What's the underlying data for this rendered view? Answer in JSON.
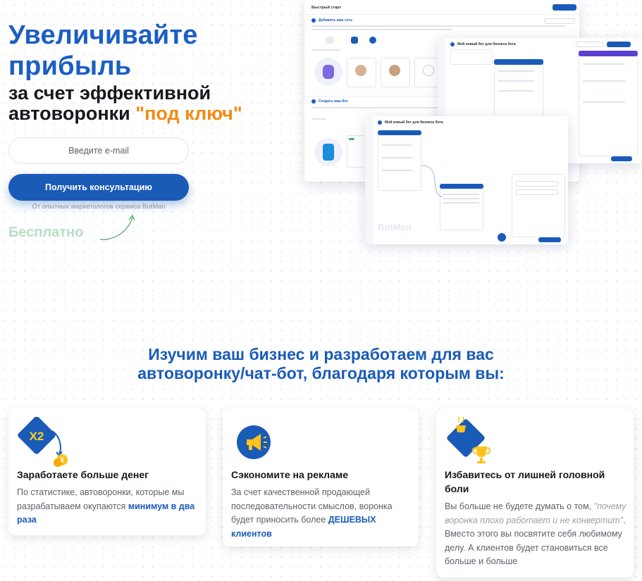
{
  "hero": {
    "title_line1": "Увеличивайте",
    "title_line2": "прибыль",
    "subtitle_line1": "за счет эффективной",
    "subtitle_line2_prefix": "автоворонки ",
    "subtitle_highlight": "\"под ключ\"",
    "email_placeholder": "Введите e-mail",
    "cta_label": "Получить консультацию",
    "cta_note": "От опытных маркетологов сервиса BotMan",
    "free_label": "Бесплатно"
  },
  "collage": {
    "screen1_title": "Быстрый старт",
    "screen1_step1": "Добавить ваш сеть",
    "screen1_step2": "Создать ваш бот",
    "screen2_title": "Мой новый бот для бизнеса бота",
    "screen3_title": "Мой новый бот для бизнеса бота",
    "watermark": "BotMan"
  },
  "section": {
    "title_line1": "Изучим ваш бизнес и разработаем для вас",
    "title_line2": "автоворонку/чат-бот, благодаря которым вы:"
  },
  "features": [
    {
      "icon": "x2-money-icon",
      "icon_text": "X2",
      "title": "Заработаете больше денег",
      "text_before": "По статистике, автоворонки, которые мы разрабатываем окупаются ",
      "text_bold": "минимум в два раза",
      "text_after": ""
    },
    {
      "icon": "megaphone-icon",
      "title": "Сэкономите на рекламе",
      "text_before": "За счет качественной продающей последовательности смыслов, воронка будет приносить более ",
      "text_bold": "ДЕШЕВЫХ клиентов",
      "text_after": ""
    },
    {
      "icon": "trophy-coffee-icon",
      "title_line1": "Избавитесь от лишней головной",
      "title_line2": "боли",
      "text_before": "Вы больше не будете думать о том, ",
      "text_italic": "\"почему воронка плохо работает и не конвертит\"",
      "text_after": ". Вместо этого вы посвятите себя любимому делу. А клиентов будет становиться все больше и больше"
    }
  ],
  "colors": {
    "primary": "#1a5bb8",
    "accent": "#f28a12",
    "free_green": "#b6dfc4"
  }
}
